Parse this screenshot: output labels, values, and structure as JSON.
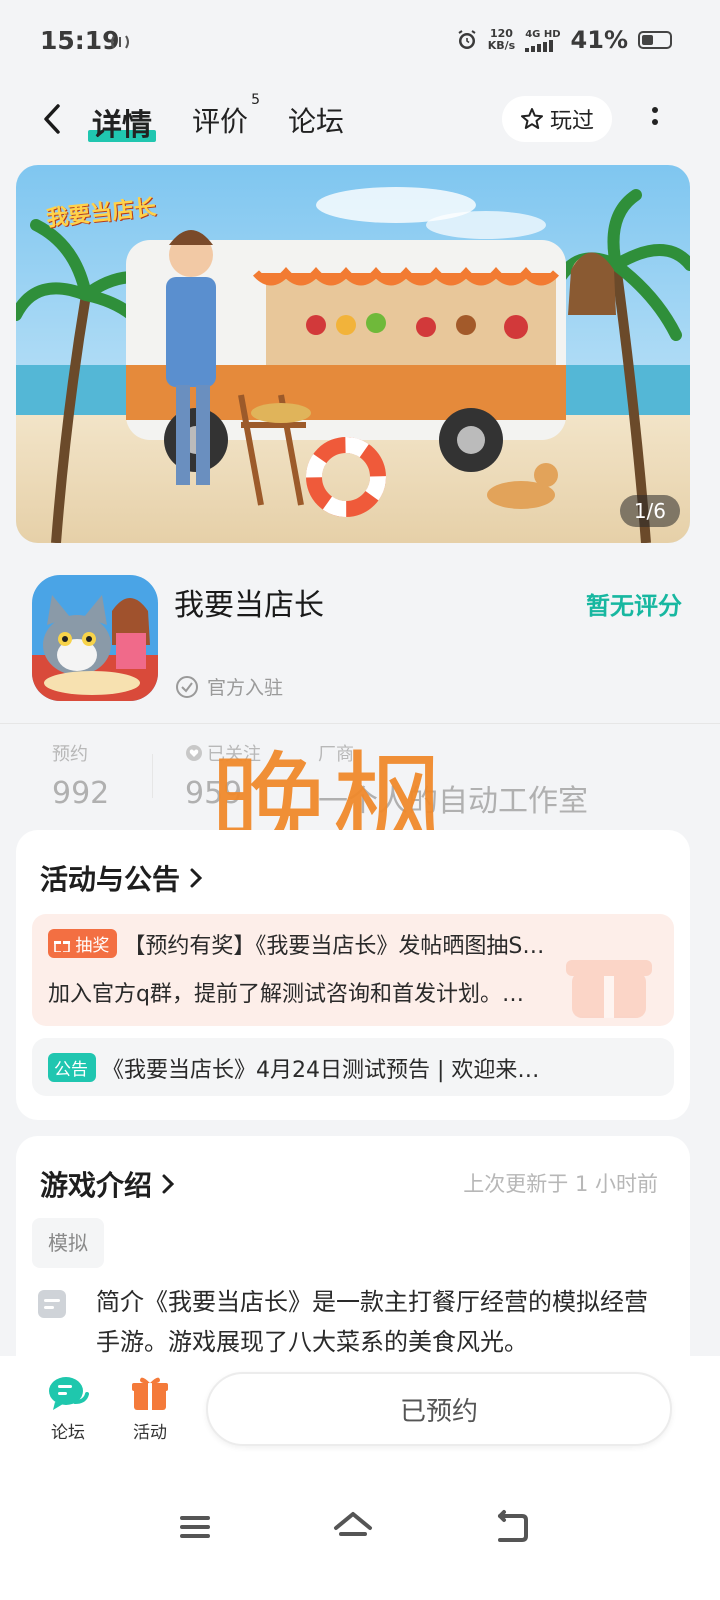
{
  "status_bar": {
    "time": "15:19",
    "net_speed_value": "120",
    "net_speed_unit": "KB/s",
    "net_type": "4G HD",
    "battery": "41%",
    "battery_level": 0.41
  },
  "nav": {
    "tabs": [
      {
        "label": "详情",
        "active": true
      },
      {
        "label": "评价",
        "badge": "5"
      },
      {
        "label": "论坛"
      }
    ],
    "played_label": "玩过"
  },
  "banner": {
    "logo_text": "我要当店长",
    "counter": "1/6"
  },
  "app": {
    "name": "我要当店长",
    "rating_text": "暂无评分",
    "official_label": "官方入驻"
  },
  "stats": [
    {
      "label": "预约",
      "value": "992"
    },
    {
      "label": "已关注",
      "value": "959"
    },
    {
      "label": "厂商",
      "value": "一个人的自动工作室"
    }
  ],
  "watermark": "晚枫",
  "events_card": {
    "title": "活动与公告",
    "prize_event": {
      "tag": "抽奖",
      "line1": "【预约有奖】《我要当店长》发帖晒图抽S…",
      "line2": "加入官方q群，提前了解测试咨询和首发计划。…"
    },
    "notice": {
      "tag": "公告",
      "text": "《我要当店长》4月24日测试预告 | 欢迎来…"
    }
  },
  "intro_card": {
    "title": "游戏介绍",
    "updated": "上次更新于 1 小时前",
    "genre": "模拟",
    "text": "简介《我要当店长》是一款主打餐厅经营的模拟经营手游。游戏展现了八大菜系的美食风光。"
  },
  "bottom_bar": {
    "forum_label": "论坛",
    "activity_label": "活动",
    "reserved_label": "已预约"
  },
  "colors": {
    "accent": "#20c6b0",
    "rating": "#17b7a0",
    "prize_tag": "#f36f42",
    "watermark": "#f08a2c"
  }
}
